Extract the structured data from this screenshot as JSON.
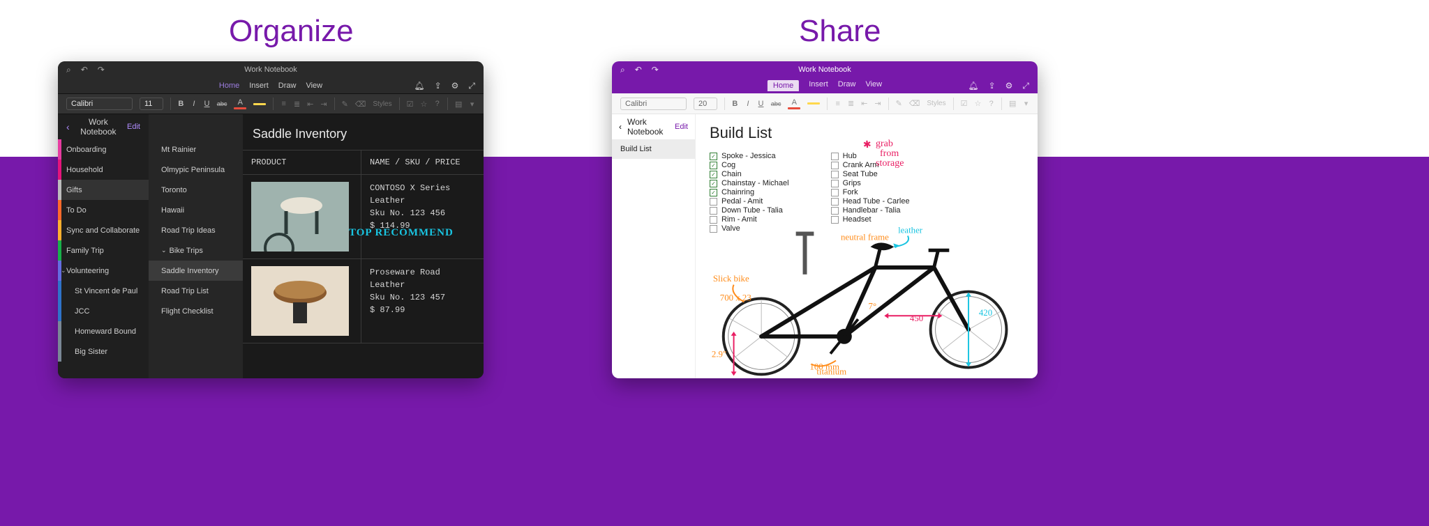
{
  "hero": {
    "organize": "Organize",
    "share": "Share"
  },
  "dark": {
    "notebook_title": "Work Notebook",
    "tabs": {
      "home": "Home",
      "insert": "Insert",
      "draw": "Draw",
      "view": "View"
    },
    "font": {
      "name": "Calibri",
      "size": "11"
    },
    "styles_label": "Styles",
    "pages_header": "Work Notebook",
    "edit": "Edit",
    "sections": [
      {
        "label": "Onboarding",
        "color": "#e73ca1"
      },
      {
        "label": "Household",
        "color": "#e5147c"
      },
      {
        "label": "Gifts",
        "color": "#bdbdbd",
        "selected": true
      },
      {
        "label": "To Do",
        "color": "#ff6a2b"
      },
      {
        "label": "Sync and Collaborate",
        "color": "#ffb02e"
      },
      {
        "label": "Family Trip",
        "color": "#18b04a"
      },
      {
        "label": "Volunteering",
        "color": "#646de0",
        "expandable": true
      },
      {
        "label": "St Vincent de Paul",
        "color": "#2f73c9",
        "child": true
      },
      {
        "label": "JCC",
        "color": "#2f73c9",
        "child": true
      },
      {
        "label": "Homeward Bound",
        "color": "#7a8896",
        "child": true
      },
      {
        "label": "Big Sister",
        "color": "#7a8896",
        "child": true
      }
    ],
    "pages": [
      {
        "label": "Mt Rainier"
      },
      {
        "label": "Olmypic Peninsula"
      },
      {
        "label": "Toronto"
      },
      {
        "label": "Hawaii"
      },
      {
        "label": "Road Trip Ideas"
      },
      {
        "label": "Bike Trips",
        "expandable": true
      },
      {
        "label": "Saddle Inventory",
        "selected": true
      },
      {
        "label": "Road Trip List"
      },
      {
        "label": "Flight Checklist"
      }
    ],
    "content": {
      "title": "Saddle Inventory",
      "col1": "PRODUCT",
      "col2": "NAME / SKU / PRICE",
      "row1": {
        "name": "CONTOSO X Series Leather",
        "sku": "Sku No. 123 456",
        "price": "$ 114.99"
      },
      "row2": {
        "name": "Proseware Road Leather",
        "sku": "Sku No. 123 457",
        "price": "$ 87.99"
      },
      "annotation": "TOP RECOMMEND"
    }
  },
  "light": {
    "notebook_title": "Work Notebook",
    "tabs": {
      "home": "Home",
      "insert": "Insert",
      "draw": "Draw",
      "view": "View"
    },
    "font": {
      "name": "Calibri",
      "size": "20"
    },
    "styles_label": "Styles",
    "pages_header": "Work Notebook",
    "edit": "Edit",
    "page_item": "Build List",
    "content_title": "Build List",
    "col1": [
      {
        "label": "Spoke - Jessica",
        "checked": true
      },
      {
        "label": "Cog",
        "checked": true
      },
      {
        "label": "Chain",
        "checked": true
      },
      {
        "label": "Chainstay - Michael",
        "checked": true
      },
      {
        "label": "Chainring",
        "checked": true
      },
      {
        "label": "Pedal - Amit",
        "checked": false
      },
      {
        "label": "Down Tube - Talia",
        "checked": false
      },
      {
        "label": "Rim - Amit",
        "checked": false
      },
      {
        "label": "Valve",
        "checked": false
      }
    ],
    "col2": [
      {
        "label": "Hub",
        "checked": false
      },
      {
        "label": "Crank Arm",
        "checked": false
      },
      {
        "label": "Seat Tube",
        "checked": false
      },
      {
        "label": "Grips",
        "checked": false
      },
      {
        "label": "Fork",
        "checked": false
      },
      {
        "label": "Head Tube - Carlee",
        "checked": false
      },
      {
        "label": "Handlebar - Talia",
        "checked": false
      },
      {
        "label": "Headset",
        "checked": false
      }
    ],
    "pink_note_l1": "grab",
    "pink_note_l2": "from",
    "pink_note_l3": "storage",
    "ink": {
      "slick": "Slick bike",
      "dim1": "700 x 23",
      "dim2": "2.9\"",
      "dim3": "100 mm",
      "neutral": "neutral frame",
      "dim4": "7°",
      "dim5": "450",
      "dim6": "420",
      "leather": "leather",
      "titanium": "titanium"
    }
  }
}
